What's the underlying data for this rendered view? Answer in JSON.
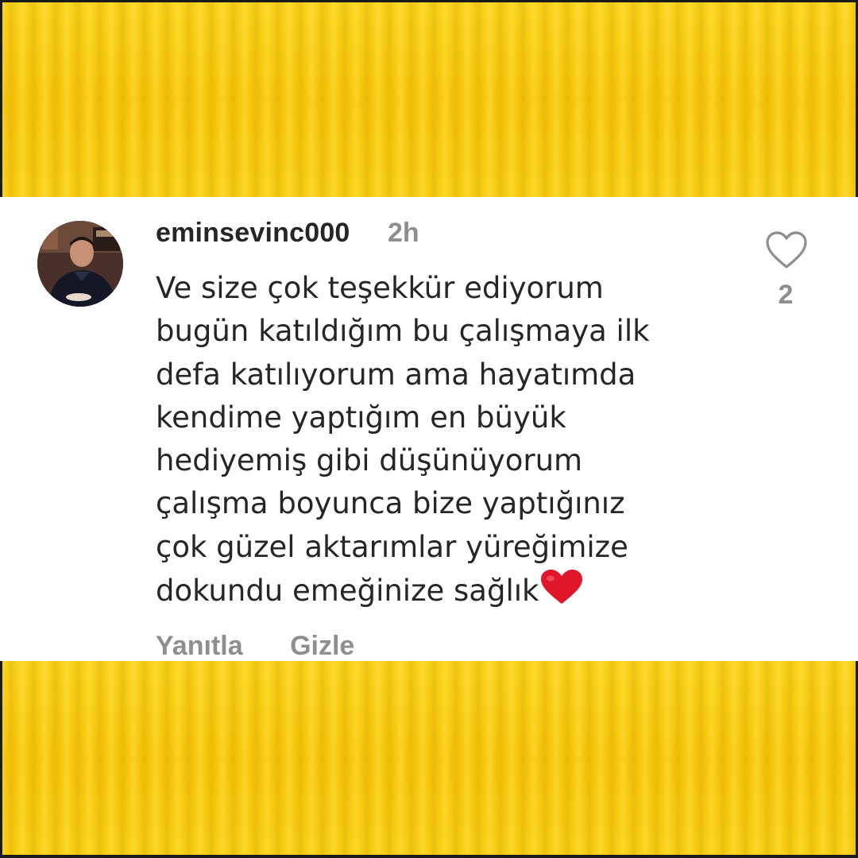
{
  "comment": {
    "username": "eminsevinc000",
    "timestamp": "2h",
    "text": "Ve size çok teşekkür ediyorum\nbugün katıldığım bu çalışmaya ilk\ndefa katılıyorum ama hayatımda\nkendime yaptığım en büyük\nhediyemiş gibi düşünüyorum\nçalışma boyunca bize yaptığınız\nçok güzel aktarımlar yüreğimize\ndokundu emeğinize sağlık",
    "trailing_emoji": "red-heart",
    "like_count": "2",
    "like_icon": "heart-outline-icon",
    "actions": {
      "reply_label": "Yanıtla",
      "hide_label": "Gizle"
    }
  },
  "colors": {
    "background_band": "#f8cb0e",
    "card": "#ffffff",
    "primary_text": "#262626",
    "secondary_text": "#8e8e8e",
    "heart": "#e0162b"
  }
}
